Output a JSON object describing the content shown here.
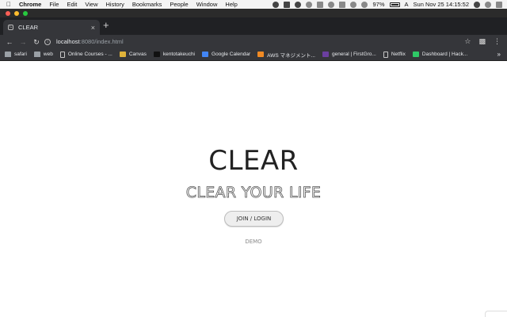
{
  "menubar": {
    "app_name": "Chrome",
    "menus": [
      "File",
      "Edit",
      "View",
      "History",
      "Bookmarks",
      "People",
      "Window",
      "Help"
    ],
    "battery": "97%",
    "input_source": "A",
    "clock": "Sun Nov 25  14:15:52"
  },
  "browser": {
    "tab_title": "CLEAR",
    "tab_favicon": "C",
    "url_host": "localhost",
    "url_path": ":8080/index.html",
    "bookmarks": [
      {
        "label": "safari",
        "icon": "folder-icon",
        "color": "#9aa0a6"
      },
      {
        "label": "web",
        "icon": "folder-icon",
        "color": "#9aa0a6"
      },
      {
        "label": "Online Courses - ...",
        "icon": "page-icon",
        "color": "#c8c8c8"
      },
      {
        "label": "Canvas",
        "icon": "canvas-icon",
        "color": "#e0b33a"
      },
      {
        "label": "kentotakeuchi",
        "icon": "github-icon",
        "color": "#111111"
      },
      {
        "label": "Google Calendar",
        "icon": "calendar-icon",
        "color": "#4285f4"
      },
      {
        "label": "AWS マネジメント...",
        "icon": "aws-icon",
        "color": "#f08a24"
      },
      {
        "label": "general | FirstGro...",
        "icon": "slack-icon",
        "color": "#6b3fa0"
      },
      {
        "label": "Netflix",
        "icon": "page-icon",
        "color": "#c8c8c8"
      },
      {
        "label": "Dashboard | Hack...",
        "icon": "hackerrank-icon",
        "color": "#2ec866"
      }
    ],
    "bookmarks_more": "»"
  },
  "page": {
    "title": "CLEAR",
    "subtitle": "CLEAR YOUR LIFE",
    "join_button": "JOIN / LOGIN",
    "demo_link": "DEMO"
  }
}
